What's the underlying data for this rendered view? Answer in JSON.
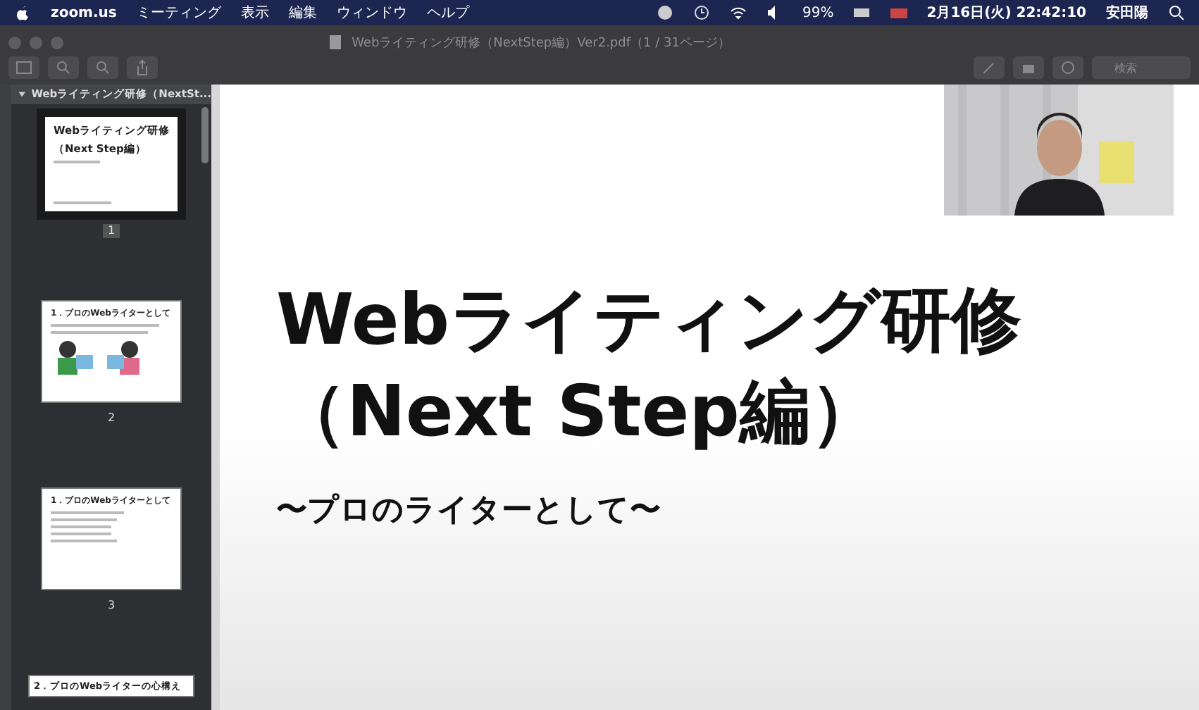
{
  "menubar": {
    "app": "zoom.us",
    "menus": [
      "ミーティング",
      "表示",
      "編集",
      "ウィンドウ",
      "ヘルプ"
    ],
    "battery": "99%",
    "clock": "2月16日(火) 22:42:10",
    "user": "安田陽"
  },
  "window": {
    "title": "Webライティング研修（NextStep編）Ver2.pdf（1 / 31ページ）",
    "search": {
      "placeholder": "検索"
    }
  },
  "sidebar": {
    "header": "Webライティング研修（NextSt...",
    "pages": [
      {
        "kind": "cover",
        "number": "1",
        "selected": true,
        "title": "Webライティング研修",
        "title_2": "（Next Step編）"
      },
      {
        "kind": "illustrated",
        "number": "2",
        "selected": false,
        "title": "1．プロのWebライターとして"
      },
      {
        "kind": "list",
        "number": "3",
        "selected": false,
        "title": "1．プロのWebライターとして"
      },
      {
        "kind": "partial",
        "selected": false,
        "title": "2．プロのWebライターの心構え"
      }
    ]
  },
  "slide": {
    "title": "Webライティング研修",
    "title_2": "（Next Step編）",
    "subtitle": "〜プロのライターとして〜"
  }
}
